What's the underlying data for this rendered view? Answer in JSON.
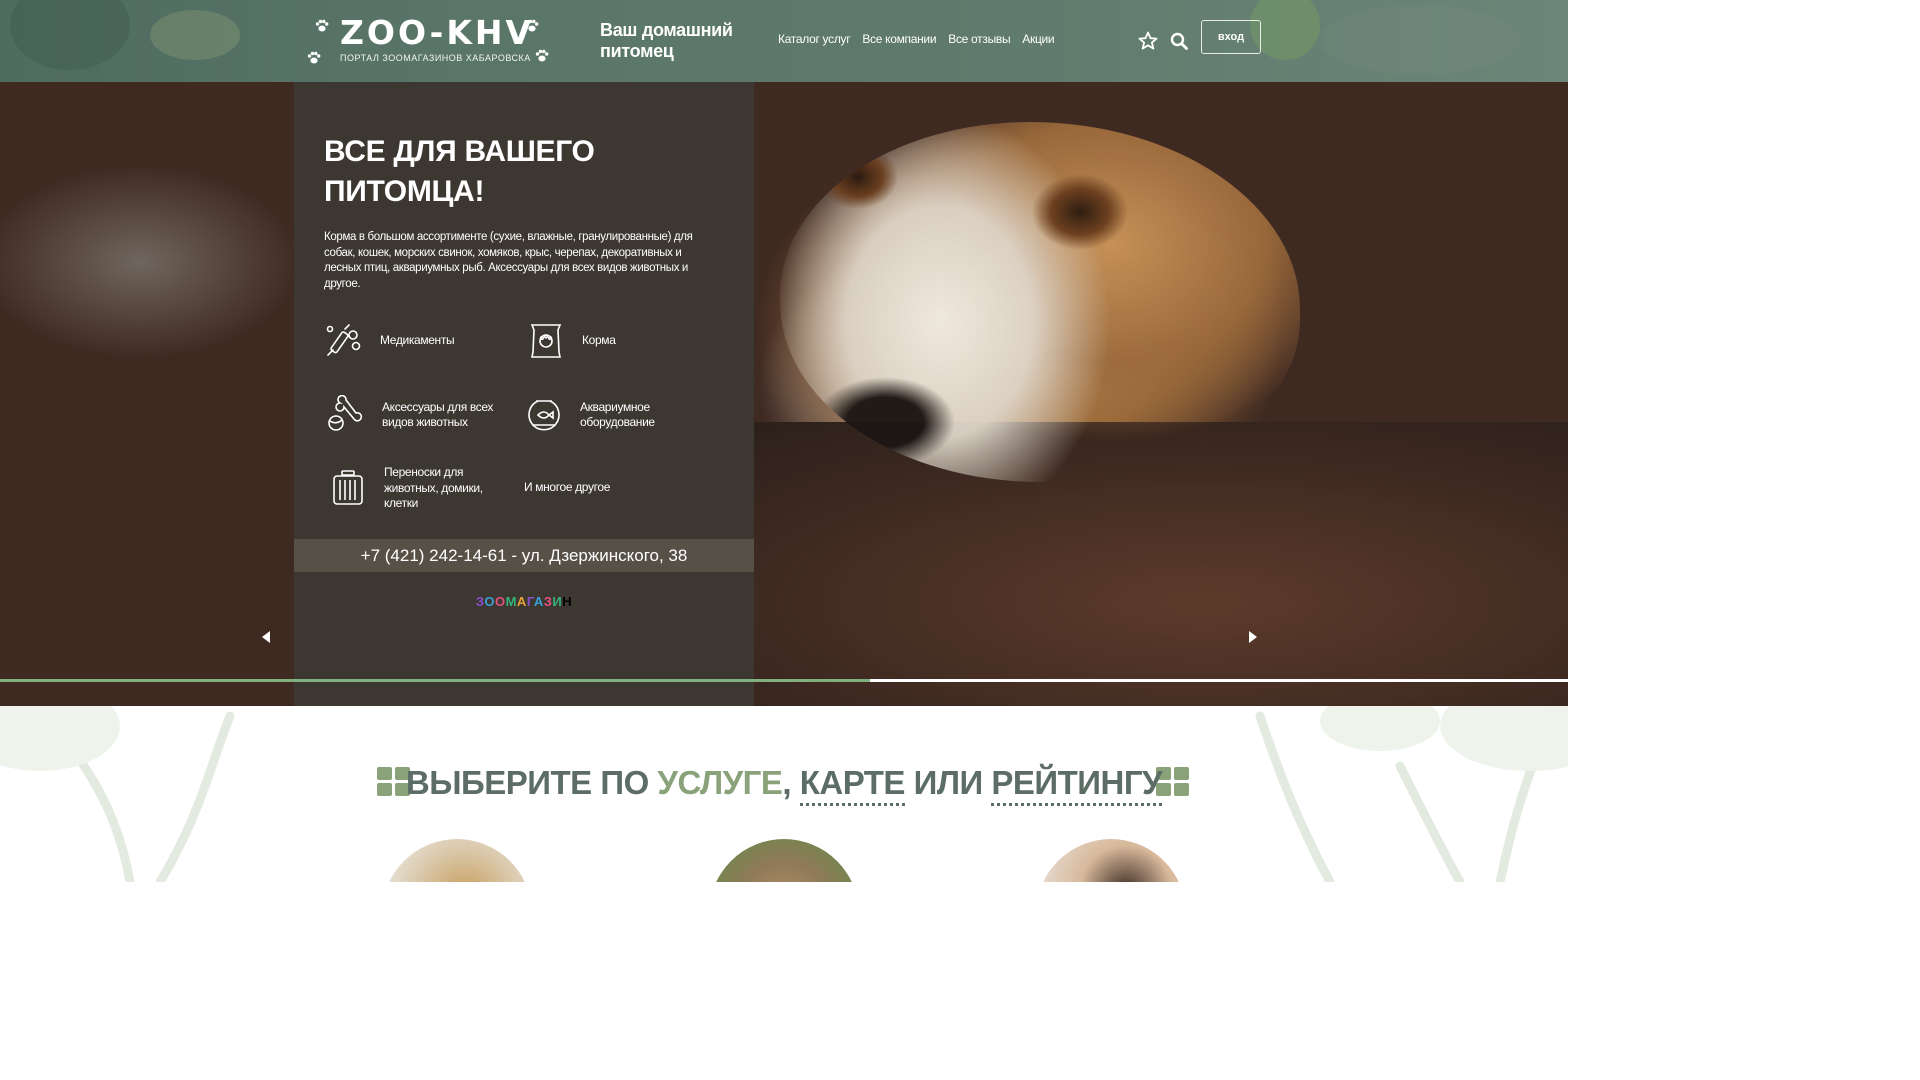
{
  "header": {
    "logo_text": "ZOO-KHV",
    "logo_subtitle": "ПОРТАЛ ЗООМАГАЗИНОВ ХАБАРОВСКА",
    "tagline": "Ваш домашний питомец",
    "nav": [
      {
        "label": "Каталог услуг"
      },
      {
        "label": "Все компании"
      },
      {
        "label": "Все отзывы"
      },
      {
        "label": "Акции"
      }
    ],
    "favorites_icon": "star-icon",
    "search_icon": "search-icon",
    "login_label": "вход"
  },
  "hero": {
    "title": "ВСЕ ДЛЯ ВАШЕГО ПИТОМЦА!",
    "description": "Корма в большом ассортименте (сухие, влажные, гранулированные) для собак, кошек, морских свинок, хомяков, крыс, черепах, декоративных и лесных птиц, аквариумных рыб. Аксессуары для всех видов животных и другое.",
    "features": [
      {
        "label": "Медикаменты",
        "icon": "medicine-icon"
      },
      {
        "label": "Корма",
        "icon": "pet-food-icon"
      },
      {
        "label": "Аксессуары для всех видов животных",
        "icon": "bone-ball-icon"
      },
      {
        "label": "Аквариумное оборудование",
        "icon": "aquarium-icon"
      },
      {
        "label": "Переноски для животных, домики, клетки",
        "icon": "cage-icon"
      },
      {
        "label": "И многое другое",
        "icon": ""
      }
    ],
    "contact": "+7 (421) 242-14-61 - ул. Дзержинского, 38",
    "shop_brand": "ЗООМАГАЗИН",
    "slider_progress": 0.555
  },
  "section": {
    "title_part1": "ВЫБЕРИТЕ ПО ",
    "title_service": "УСЛУГЕ",
    "title_comma": ", ",
    "title_map": "КАРТЕ",
    "title_or": " ИЛИ ",
    "title_rating": "РЕЙТИНГУ"
  },
  "colors": {
    "header_bg": "#5a7669",
    "panel_bg": "#3c3a34",
    "accent_green": "#7fb07e",
    "title_color": "#5b6d64",
    "title_highlight": "#8aa27a"
  }
}
